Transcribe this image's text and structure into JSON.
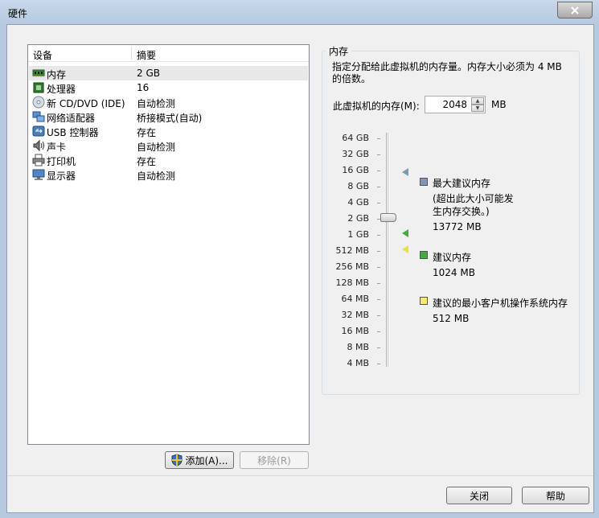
{
  "window": {
    "title": "硬件"
  },
  "devices": {
    "header": {
      "device": "设备",
      "summary": "摘要"
    },
    "rows": [
      {
        "name": "内存",
        "summary": "2 GB",
        "icon": "memory-icon"
      },
      {
        "name": "处理器",
        "summary": "16",
        "icon": "cpu-icon"
      },
      {
        "name": "新 CD/DVD (IDE)",
        "summary": "自动检测",
        "icon": "cd-dvd-icon"
      },
      {
        "name": "网络适配器",
        "summary": "桥接模式(自动)",
        "icon": "network-adapter-icon"
      },
      {
        "name": "USB 控制器",
        "summary": "存在",
        "icon": "usb-icon"
      },
      {
        "name": "声卡",
        "summary": "自动检测",
        "icon": "sound-card-icon"
      },
      {
        "name": "打印机",
        "summary": "存在",
        "icon": "printer-icon"
      },
      {
        "name": "显示器",
        "summary": "自动检测",
        "icon": "display-icon"
      }
    ],
    "selected_index": 0
  },
  "buttons": {
    "add": "添加(A)...",
    "remove": "移除(R)",
    "close": "关闭",
    "help": "帮助"
  },
  "memory": {
    "group_title": "内存",
    "description": "指定分配给此虚拟机的内存量。内存大小必须为 4 MB 的倍数。",
    "field_label": "此虚拟机的内存(M):",
    "value": "2048",
    "unit": "MB",
    "scale_labels": [
      "64 GB",
      "32 GB",
      "16 GB",
      "8 GB",
      "4 GB",
      "2 GB",
      "1 GB",
      "512 MB",
      "256 MB",
      "128 MB",
      "64 MB",
      "32 MB",
      "16 MB",
      "8 MB",
      "4 MB"
    ],
    "legend": {
      "max_title": "最大建议内存",
      "max_note": "(超出此大小可能发生内存交换。)",
      "max_value": "13772 MB",
      "rec_title": "建议内存",
      "rec_value": "1024 MB",
      "min_title": "建议的最小客户机操作系统内存",
      "min_value": "512 MB"
    },
    "colors": {
      "max": "#7f98b8",
      "recommended": "#3fae3f",
      "minimum": "#f2ee6a"
    }
  }
}
